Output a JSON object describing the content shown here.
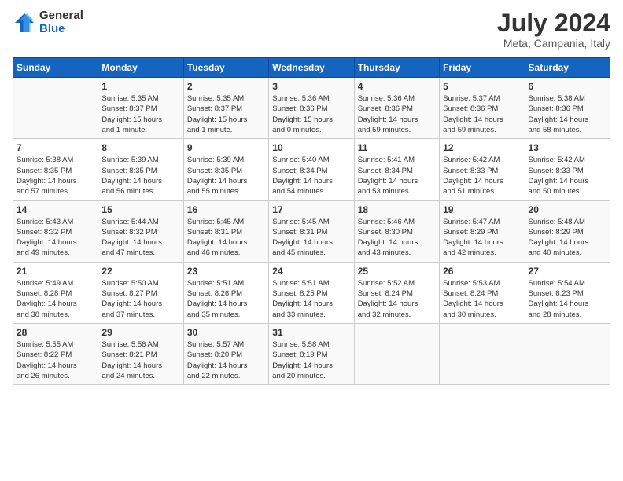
{
  "header": {
    "logo_general": "General",
    "logo_blue": "Blue",
    "month_title": "July 2024",
    "location": "Meta, Campania, Italy"
  },
  "calendar": {
    "headers": [
      "Sunday",
      "Monday",
      "Tuesday",
      "Wednesday",
      "Thursday",
      "Friday",
      "Saturday"
    ],
    "weeks": [
      [
        {
          "day": "",
          "info": ""
        },
        {
          "day": "1",
          "info": "Sunrise: 5:35 AM\nSunset: 8:37 PM\nDaylight: 15 hours\nand 1 minute."
        },
        {
          "day": "2",
          "info": "Sunrise: 5:35 AM\nSunset: 8:37 PM\nDaylight: 15 hours\nand 1 minute."
        },
        {
          "day": "3",
          "info": "Sunrise: 5:36 AM\nSunset: 8:36 PM\nDaylight: 15 hours\nand 0 minutes."
        },
        {
          "day": "4",
          "info": "Sunrise: 5:36 AM\nSunset: 8:36 PM\nDaylight: 14 hours\nand 59 minutes."
        },
        {
          "day": "5",
          "info": "Sunrise: 5:37 AM\nSunset: 8:36 PM\nDaylight: 14 hours\nand 59 minutes."
        },
        {
          "day": "6",
          "info": "Sunrise: 5:38 AM\nSunset: 8:36 PM\nDaylight: 14 hours\nand 58 minutes."
        }
      ],
      [
        {
          "day": "7",
          "info": "Sunrise: 5:38 AM\nSunset: 8:35 PM\nDaylight: 14 hours\nand 57 minutes."
        },
        {
          "day": "8",
          "info": "Sunrise: 5:39 AM\nSunset: 8:35 PM\nDaylight: 14 hours\nand 56 minutes."
        },
        {
          "day": "9",
          "info": "Sunrise: 5:39 AM\nSunset: 8:35 PM\nDaylight: 14 hours\nand 55 minutes."
        },
        {
          "day": "10",
          "info": "Sunrise: 5:40 AM\nSunset: 8:34 PM\nDaylight: 14 hours\nand 54 minutes."
        },
        {
          "day": "11",
          "info": "Sunrise: 5:41 AM\nSunset: 8:34 PM\nDaylight: 14 hours\nand 53 minutes."
        },
        {
          "day": "12",
          "info": "Sunrise: 5:42 AM\nSunset: 8:33 PM\nDaylight: 14 hours\nand 51 minutes."
        },
        {
          "day": "13",
          "info": "Sunrise: 5:42 AM\nSunset: 8:33 PM\nDaylight: 14 hours\nand 50 minutes."
        }
      ],
      [
        {
          "day": "14",
          "info": "Sunrise: 5:43 AM\nSunset: 8:32 PM\nDaylight: 14 hours\nand 49 minutes."
        },
        {
          "day": "15",
          "info": "Sunrise: 5:44 AM\nSunset: 8:32 PM\nDaylight: 14 hours\nand 47 minutes."
        },
        {
          "day": "16",
          "info": "Sunrise: 5:45 AM\nSunset: 8:31 PM\nDaylight: 14 hours\nand 46 minutes."
        },
        {
          "day": "17",
          "info": "Sunrise: 5:45 AM\nSunset: 8:31 PM\nDaylight: 14 hours\nand 45 minutes."
        },
        {
          "day": "18",
          "info": "Sunrise: 5:46 AM\nSunset: 8:30 PM\nDaylight: 14 hours\nand 43 minutes."
        },
        {
          "day": "19",
          "info": "Sunrise: 5:47 AM\nSunset: 8:29 PM\nDaylight: 14 hours\nand 42 minutes."
        },
        {
          "day": "20",
          "info": "Sunrise: 5:48 AM\nSunset: 8:29 PM\nDaylight: 14 hours\nand 40 minutes."
        }
      ],
      [
        {
          "day": "21",
          "info": "Sunrise: 5:49 AM\nSunset: 8:28 PM\nDaylight: 14 hours\nand 38 minutes."
        },
        {
          "day": "22",
          "info": "Sunrise: 5:50 AM\nSunset: 8:27 PM\nDaylight: 14 hours\nand 37 minutes."
        },
        {
          "day": "23",
          "info": "Sunrise: 5:51 AM\nSunset: 8:26 PM\nDaylight: 14 hours\nand 35 minutes."
        },
        {
          "day": "24",
          "info": "Sunrise: 5:51 AM\nSunset: 8:25 PM\nDaylight: 14 hours\nand 33 minutes."
        },
        {
          "day": "25",
          "info": "Sunrise: 5:52 AM\nSunset: 8:24 PM\nDaylight: 14 hours\nand 32 minutes."
        },
        {
          "day": "26",
          "info": "Sunrise: 5:53 AM\nSunset: 8:24 PM\nDaylight: 14 hours\nand 30 minutes."
        },
        {
          "day": "27",
          "info": "Sunrise: 5:54 AM\nSunset: 8:23 PM\nDaylight: 14 hours\nand 28 minutes."
        }
      ],
      [
        {
          "day": "28",
          "info": "Sunrise: 5:55 AM\nSunset: 8:22 PM\nDaylight: 14 hours\nand 26 minutes."
        },
        {
          "day": "29",
          "info": "Sunrise: 5:56 AM\nSunset: 8:21 PM\nDaylight: 14 hours\nand 24 minutes."
        },
        {
          "day": "30",
          "info": "Sunrise: 5:57 AM\nSunset: 8:20 PM\nDaylight: 14 hours\nand 22 minutes."
        },
        {
          "day": "31",
          "info": "Sunrise: 5:58 AM\nSunset: 8:19 PM\nDaylight: 14 hours\nand 20 minutes."
        },
        {
          "day": "",
          "info": ""
        },
        {
          "day": "",
          "info": ""
        },
        {
          "day": "",
          "info": ""
        }
      ]
    ]
  }
}
